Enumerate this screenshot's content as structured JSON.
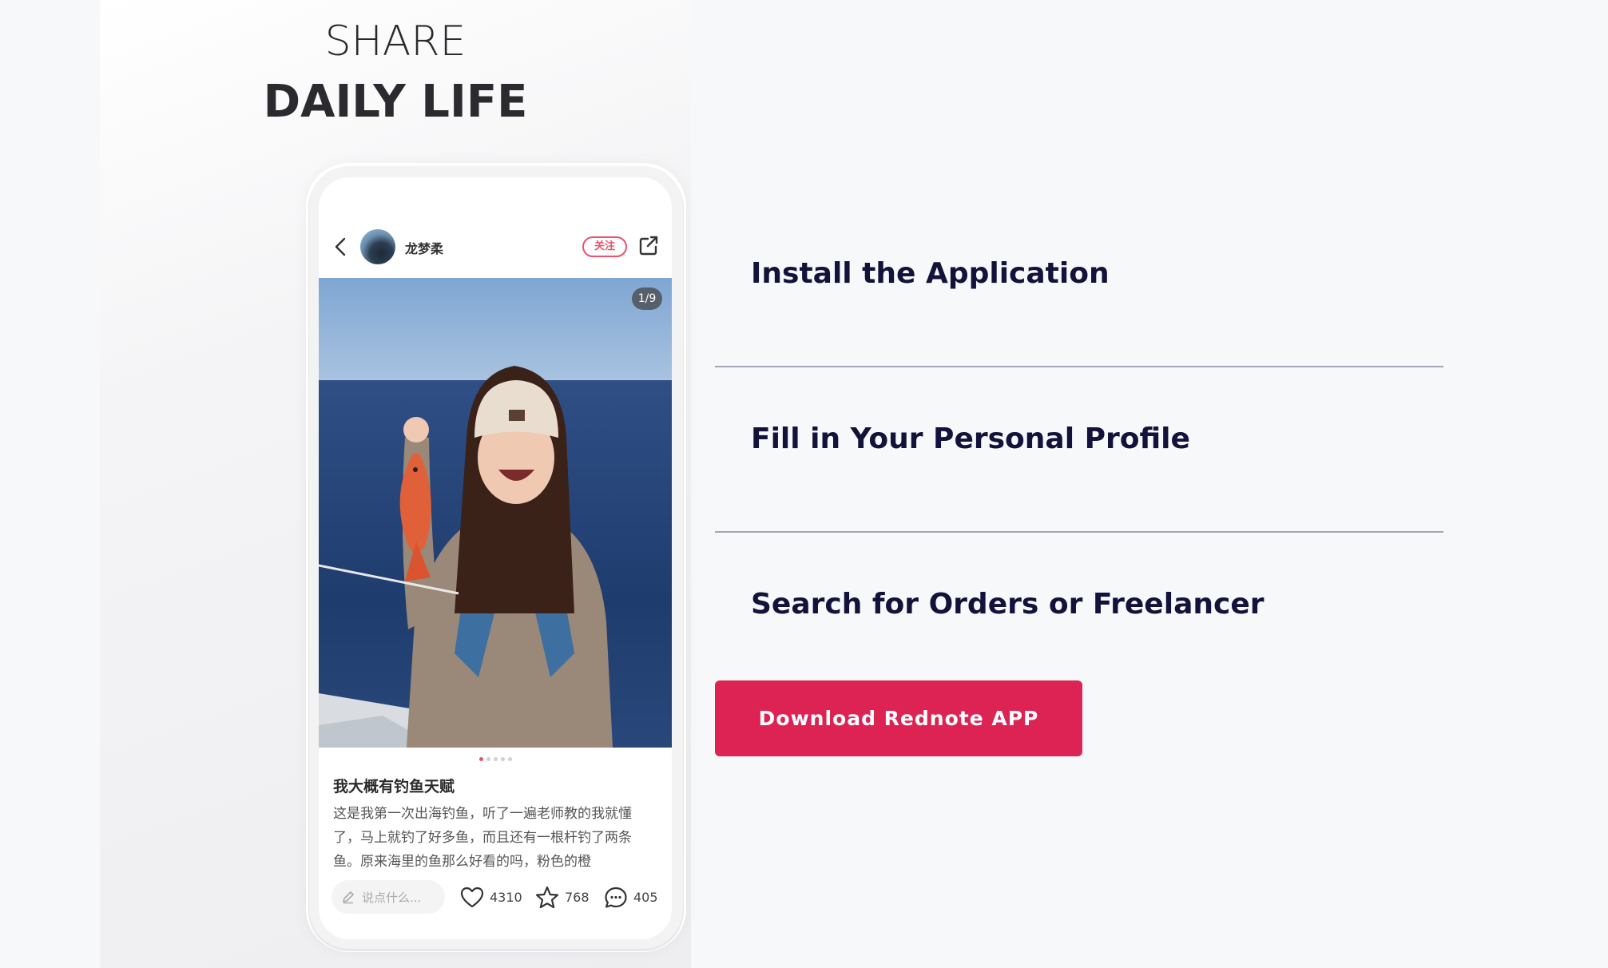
{
  "showcase": {
    "headline_line1": "SHARE",
    "headline_line2": "DAILY LIFE"
  },
  "phone": {
    "author": "龙梦柔",
    "follow_label": "关注",
    "photo_counter": "1/9",
    "carousel_dots": 5,
    "post_title": "我大概有钓鱼天赋",
    "post_body": "这是我第一次出海钓鱼，听了一遍老师教的我就懂了，马上就钓了好多鱼，而且还有一根杆钓了两条鱼。原来海里的鱼那么好看的吗，粉色的橙",
    "comment_placeholder": "说点什么...",
    "likes": "4310",
    "favorites": "768",
    "comments": "405"
  },
  "steps": [
    {
      "label": "Install the Application"
    },
    {
      "label": "Fill in Your Personal Profile"
    },
    {
      "label": "Search for Orders or Freelancer"
    }
  ],
  "cta": {
    "label": "Download Rednote APP",
    "color": "#dc2353"
  },
  "colors": {
    "step_text": "#12123a",
    "divider": "#a3a6b8",
    "brand_red": "#e8526d"
  },
  "icons": [
    "back-arrow-icon",
    "share-external-icon",
    "pen-icon",
    "heart-icon",
    "star-icon",
    "comment-bubble-icon"
  ]
}
